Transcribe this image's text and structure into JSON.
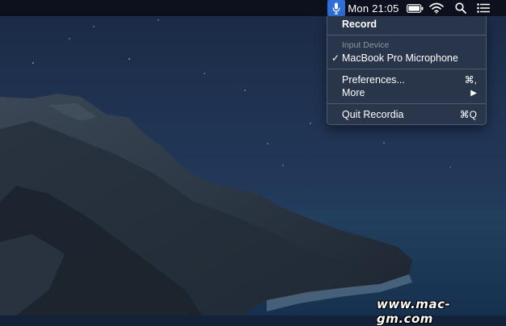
{
  "menubar": {
    "mic_icon": "microphone-icon",
    "clock": "Mon 21:05",
    "battery_icon": "battery-icon",
    "wifi_icon": "wifi-icon",
    "search_icon": "spotlight-search-icon",
    "controls_icon": "control-center-icon",
    "active_color": "#2d6fd7"
  },
  "menu": {
    "record_label": "Record",
    "input_device_header": "Input Device",
    "device_check": "✓",
    "device_label": "MacBook Pro Microphone",
    "preferences_label": "Preferences...",
    "preferences_shortcut": "⌘,",
    "more_label": "More",
    "more_arrow": "▶",
    "quit_label": "Quit Recordia",
    "quit_shortcut": "⌘Q"
  },
  "watermark": "www.mac-gm.com"
}
